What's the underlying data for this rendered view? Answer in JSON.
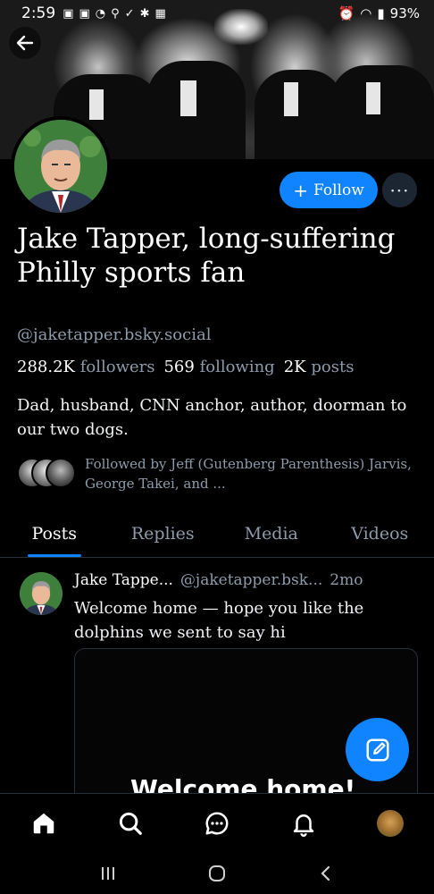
{
  "status_bar": {
    "time": "2:59",
    "battery": "93%"
  },
  "profile": {
    "display_name": "Jake Tapper, long-suffering Philly sports fan",
    "handle": "@jaketapper.bsky.social",
    "follow_label": "Follow",
    "stats": {
      "followers_count": "288.2K",
      "followers_label": "followers",
      "following_count": "569",
      "following_label": "following",
      "posts_count": "2K",
      "posts_label": "posts"
    },
    "bio": "Dad, husband, CNN anchor, author, doorman to our two dogs.",
    "followed_by": "Followed by Jeff (Gutenberg Parenthesis) Jarvis, George Takei, and ..."
  },
  "tabs": [
    {
      "label": "Posts",
      "active": true
    },
    {
      "label": "Replies",
      "active": false
    },
    {
      "label": "Media",
      "active": false
    },
    {
      "label": "Videos",
      "active": false
    }
  ],
  "post": {
    "author": "Jake Tappe...",
    "handle": "@jaketapper.bsk...",
    "time": "2mo",
    "text": "Welcome home — hope you like the dolphins we sent to say hi",
    "media_title": "Welcome home!"
  },
  "colors": {
    "accent": "#1083fe",
    "muted": "#8e9bab",
    "background": "#000000"
  },
  "icons": {
    "back": "arrow-left-icon",
    "more": "ellipsis-icon",
    "compose": "compose-icon",
    "nav": [
      "home-icon",
      "search-icon",
      "chat-icon",
      "bell-icon",
      "profile-avatar"
    ]
  }
}
